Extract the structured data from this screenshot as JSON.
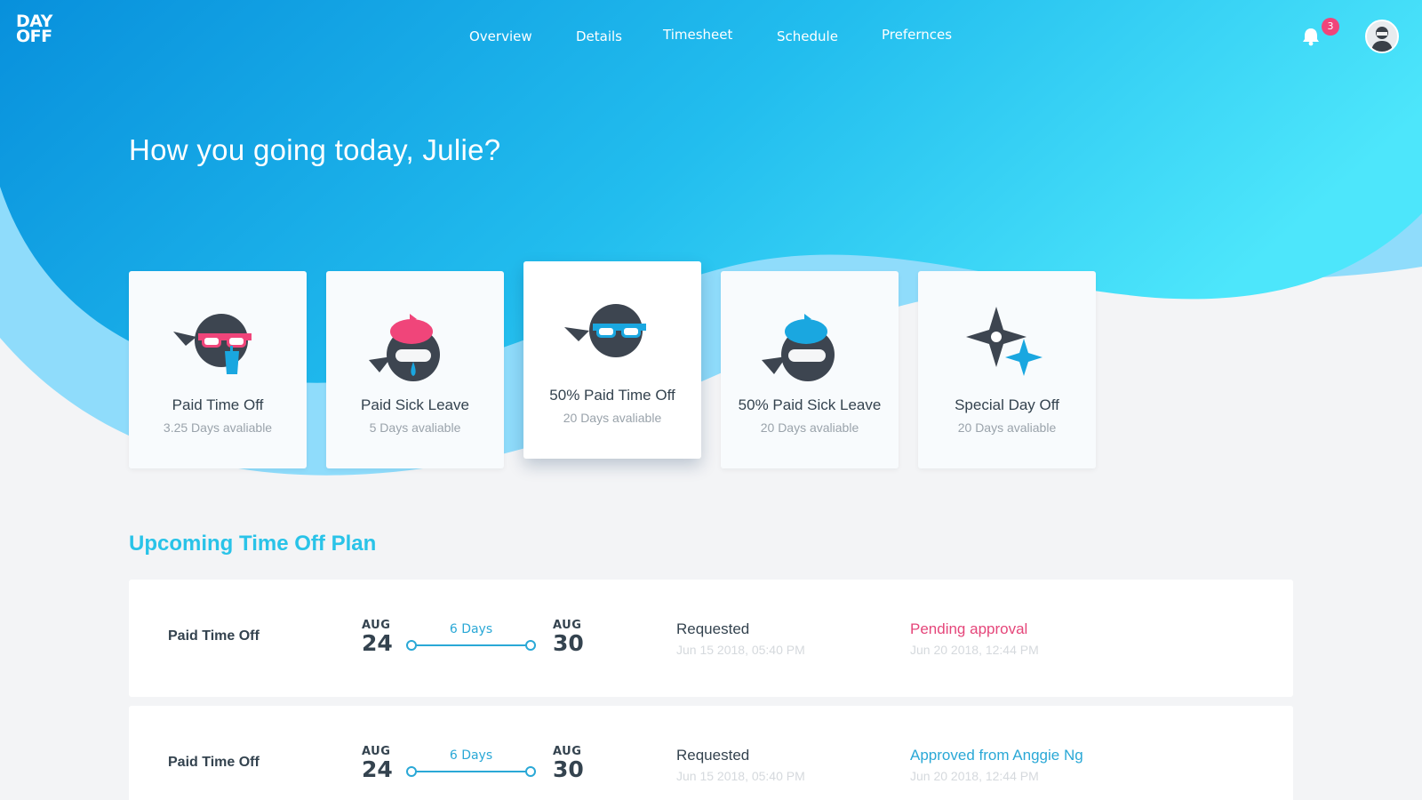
{
  "brand": {
    "logo_line1": "DAY",
    "logo_line2": "OFF"
  },
  "nav": {
    "items": [
      {
        "label": "Overview"
      },
      {
        "label": "Details"
      },
      {
        "label": "Timesheet"
      },
      {
        "label": "Schedule"
      },
      {
        "label": "Prefernces"
      }
    ]
  },
  "notifications": {
    "count": "3",
    "icon": "bell-icon"
  },
  "user": {
    "avatar_icon": "user-avatar"
  },
  "greeting": "How you going today, Julie?",
  "leave_cards": [
    {
      "title": "Paid Time Off",
      "subtitle": "3.25 Days avaliable",
      "icon": "ninja-sunglasses-drink-icon",
      "accent": "#f0457a"
    },
    {
      "title": "Paid Sick Leave",
      "subtitle": "5 Days avaliable",
      "icon": "ninja-sick-icepack-icon",
      "accent": "#f0457a"
    },
    {
      "title": "50% Paid Time Off",
      "subtitle": "20 Days avaliable",
      "icon": "ninja-sunglasses-icon",
      "accent": "#1aa7e0"
    },
    {
      "title": "50% Paid Sick Leave",
      "subtitle": "20 Days avaliable",
      "icon": "ninja-sick-blue-icepack-icon",
      "accent": "#1aa7e0"
    },
    {
      "title": "Special Day Off",
      "subtitle": "20 Days avaliable",
      "icon": "shuriken-sparkle-icon",
      "accent": "#1aa7e0"
    }
  ],
  "upcoming": {
    "title": "Upcoming Time Off Plan",
    "rows": [
      {
        "type": "Paid Time Off",
        "start_month": "AUG",
        "start_day": "24",
        "duration": "6 Days",
        "end_month": "AUG",
        "end_day": "30",
        "requested_label": "Requested",
        "requested_time": "Jun 15 2018, 05:40 PM",
        "status_label": "Pending approval",
        "status_time": "Jun 20 2018, 12:44 PM",
        "status_color": "#e5467a"
      },
      {
        "type": "Paid Time Off",
        "start_month": "AUG",
        "start_day": "24",
        "duration": "6 Days",
        "end_month": "AUG",
        "end_day": "30",
        "requested_label": "Requested",
        "requested_time": "Jun 15 2018, 05:40 PM",
        "status_label": "Approved from Anggie Ng",
        "status_time": "Jun 20 2018, 12:44 PM",
        "status_color": "#2aa8d6"
      }
    ]
  },
  "colors": {
    "primary": "#0a9de0",
    "accent_cyan": "#29c3e8",
    "pink": "#f0457a",
    "text_dark": "#34434f"
  }
}
